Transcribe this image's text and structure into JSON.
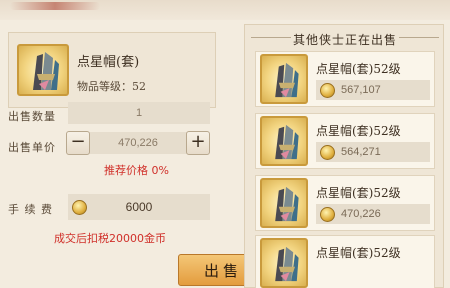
{
  "item": {
    "name": "点星帽(套)",
    "level_text": "物品等级：52"
  },
  "form": {
    "quantity_label": "出售数量",
    "quantity_value": "1",
    "price_label": "出售单价",
    "price_value": "470,226",
    "minus": "−",
    "plus": "+",
    "recommend_text": "推荐价格 0%",
    "fee_label": "手  续  费",
    "fee_value": "6000",
    "tax_note": "成交后扣税20000金币"
  },
  "sell_button": "出售",
  "market": {
    "title": "其他侠士正在出售",
    "listings": [
      {
        "name": "点星帽(套)52级",
        "price": "567,107"
      },
      {
        "name": "点星帽(套)52级",
        "price": "564,271"
      },
      {
        "name": "点星帽(套)52级",
        "price": "470,226"
      },
      {
        "name": "点星帽(套)52级",
        "price": ""
      }
    ]
  },
  "colors": {
    "accent_red": "#d0302a",
    "sell_button": "#e39c3e",
    "slot_gold": "#f2d480"
  }
}
